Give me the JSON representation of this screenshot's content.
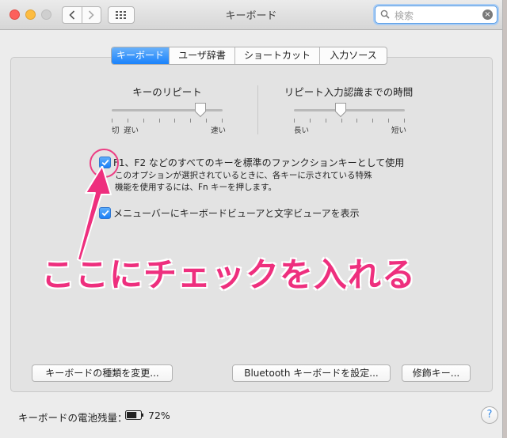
{
  "window": {
    "title": "キーボード"
  },
  "search": {
    "placeholder": "検索"
  },
  "tabs": [
    {
      "label": "キーボード",
      "active": true
    },
    {
      "label": "ユーザ辞書",
      "active": false
    },
    {
      "label": "ショートカット",
      "active": false
    },
    {
      "label": "入力ソース",
      "active": false
    }
  ],
  "key_repeat": {
    "label": "キーのリピート",
    "left_label": "切",
    "slow_label": "遅い",
    "right_label": "速い",
    "value_fraction": 0.8
  },
  "repeat_delay": {
    "label": "リピート入力認識までの時間",
    "left_label": "長い",
    "right_label": "短い",
    "value_fraction": 0.42
  },
  "options": {
    "fn_keys": {
      "label": "F1、F2 などのすべてのキーを標準のファンクションキーとして使用",
      "checked": true,
      "desc_line1": "このオプションが選択されているときに、各キーに示されている特殊",
      "desc_line2": "機能を使用するには、Fn キーを押します。"
    },
    "show_viewer": {
      "label": "メニューバーにキーボードビューアと文字ビューアを表示",
      "checked": true
    }
  },
  "annotation": {
    "text": "ここにチェックを入れる",
    "color": "#ee2f7e"
  },
  "buttons": {
    "change_type": "キーボードの種類を変更...",
    "bluetooth": "Bluetooth キーボードを設定...",
    "modifier": "修飾キー..."
  },
  "battery": {
    "label": "キーボードの電池残量：",
    "percent": "72%"
  },
  "help": {
    "label": "?"
  },
  "colors": {
    "accent": "#1a82fb",
    "annotation": "#ee2f7e"
  }
}
